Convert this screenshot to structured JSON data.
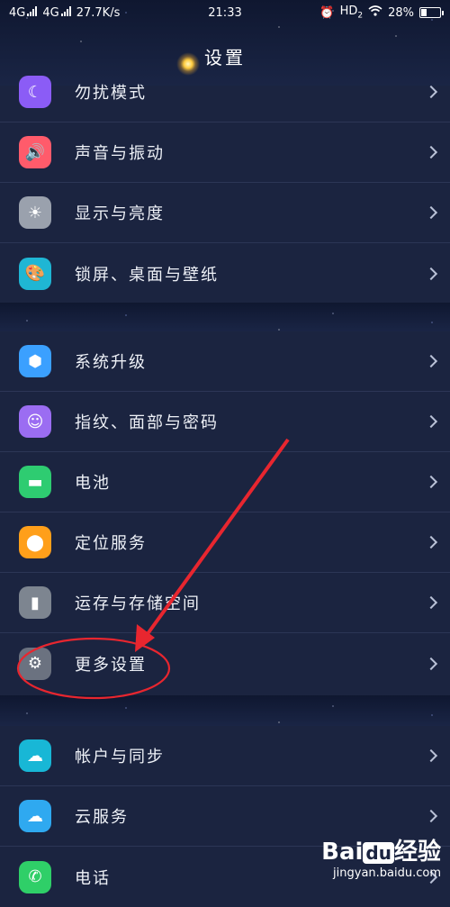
{
  "status_bar": {
    "sim1": "4G",
    "sim2": "4G",
    "net_speed": "27.7K/s",
    "time": "21:33",
    "hd": "HD",
    "hd_sub": "2",
    "battery": "28%",
    "battery_level": 0.28
  },
  "header": {
    "title": "设置"
  },
  "groups": [
    [
      {
        "label": "勿扰模式",
        "icon": "moon-icon",
        "color": "#8b5cf6"
      },
      {
        "label": "声音与振动",
        "icon": "speaker-icon",
        "color": "#ff5b6b"
      },
      {
        "label": "显示与亮度",
        "icon": "sun-icon",
        "color": "#9aa1ad"
      },
      {
        "label": "锁屏、桌面与壁纸",
        "icon": "palette-icon",
        "color": "#1fb6d4"
      }
    ],
    [
      {
        "label": "系统升级",
        "icon": "cube-icon",
        "color": "#3ba0ff"
      },
      {
        "label": "指纹、面部与密码",
        "icon": "fingerprint-icon",
        "color": "#9b6df2"
      },
      {
        "label": "电池",
        "icon": "battery-icon",
        "color": "#2ecc71"
      },
      {
        "label": "定位服务",
        "icon": "location-icon",
        "color": "#ff9f1a"
      },
      {
        "label": "运存与存储空间",
        "icon": "sd-card-icon",
        "color": "#7d8590"
      },
      {
        "label": "更多设置",
        "icon": "gear-icon",
        "color": "#6b7280"
      }
    ],
    [
      {
        "label": "帐户与同步",
        "icon": "cloud-sync-icon",
        "color": "#18b7d6"
      },
      {
        "label": "云服务",
        "icon": "cloud-icon",
        "color": "#2fa9f0"
      },
      {
        "label": "电话",
        "icon": "phone-icon",
        "color": "#2fcf68"
      }
    ]
  ],
  "watermark": {
    "logo_left": "Bai",
    "logo_du": "du",
    "logo_right": "经验",
    "site": "jingyan.baidu.com"
  }
}
